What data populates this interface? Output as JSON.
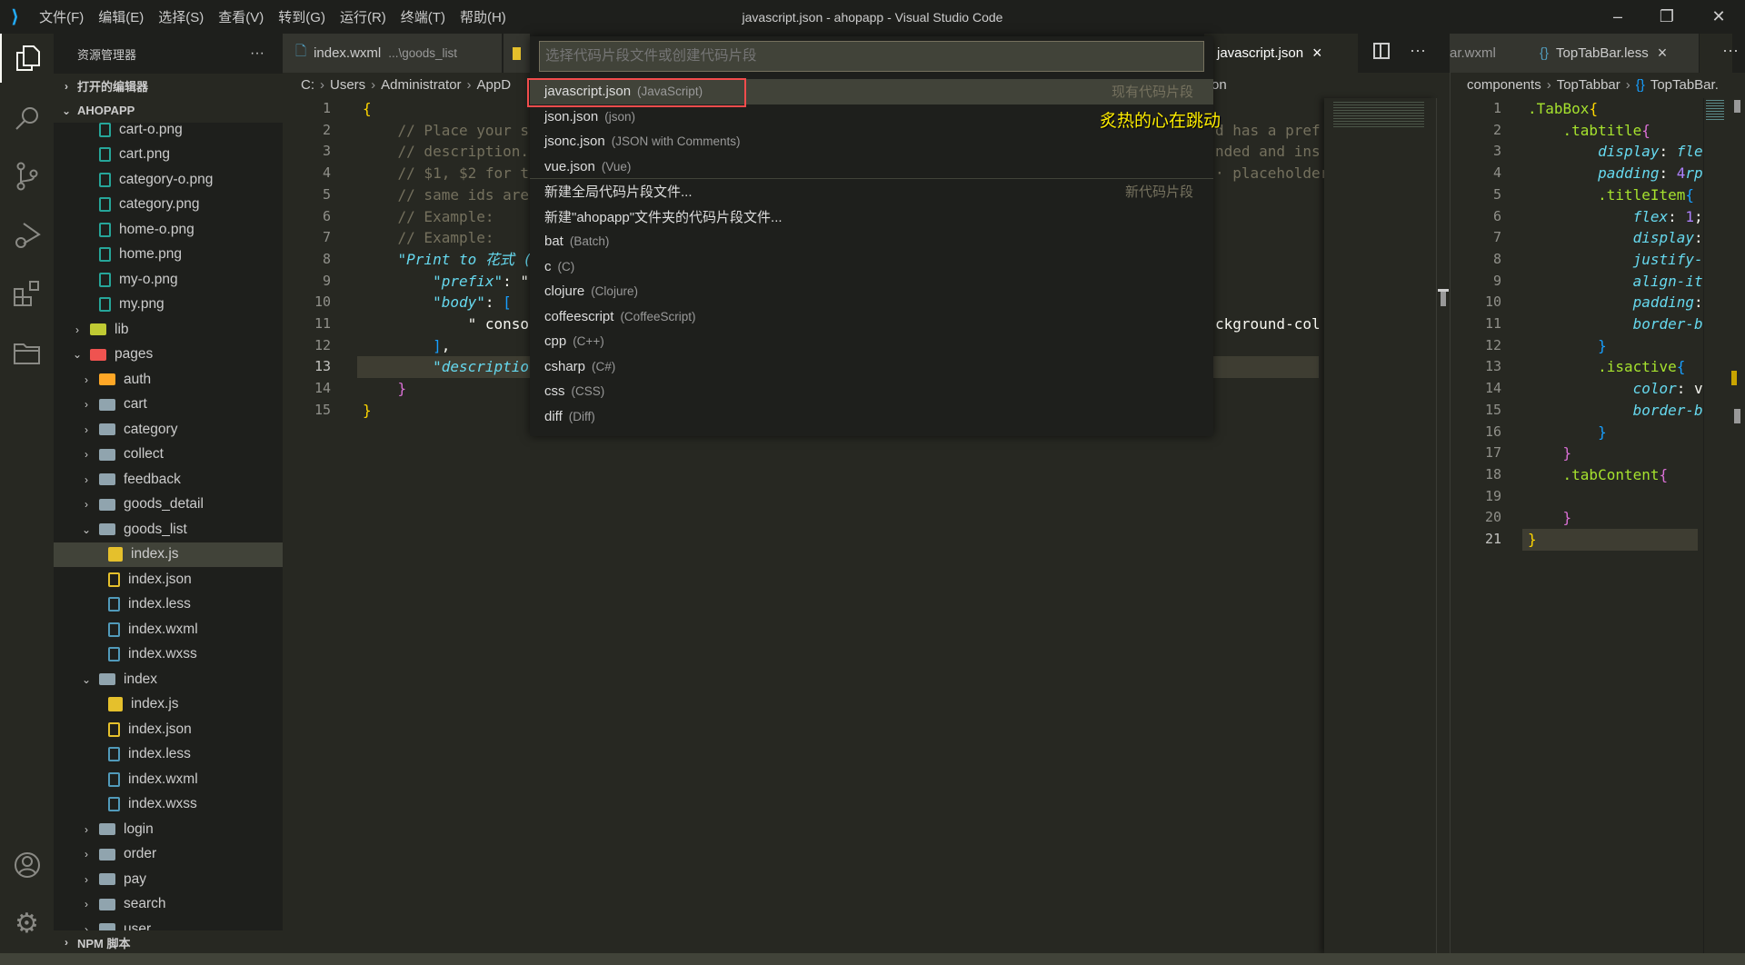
{
  "titlebar": {
    "menu": [
      "文件(F)",
      "编辑(E)",
      "选择(S)",
      "查看(V)",
      "转到(G)",
      "运行(R)",
      "终端(T)",
      "帮助(H)"
    ],
    "title": "javascript.json - ahopapp - Visual Studio Code"
  },
  "sidebar": {
    "title": "资源管理器",
    "more": "···",
    "open_editors": "打开的编辑器",
    "project": "AHOPAPP",
    "npm": "NPM 脚本",
    "tree": [
      {
        "label": "cart-o.png",
        "level": 2,
        "kind": "image"
      },
      {
        "label": "cart.png",
        "level": 2,
        "kind": "image"
      },
      {
        "label": "category-o.png",
        "level": 2,
        "kind": "image"
      },
      {
        "label": "category.png",
        "level": 2,
        "kind": "image"
      },
      {
        "label": "home-o.png",
        "level": 2,
        "kind": "image"
      },
      {
        "label": "home.png",
        "level": 2,
        "kind": "image"
      },
      {
        "label": "my-o.png",
        "level": 2,
        "kind": "image"
      },
      {
        "label": "my.png",
        "level": 2,
        "kind": "image"
      },
      {
        "label": "lib",
        "level": 1,
        "kind": "folder-lib",
        "open": false
      },
      {
        "label": "pages",
        "level": 1,
        "kind": "folder-pages",
        "open": true
      },
      {
        "label": "auth",
        "level": 2,
        "kind": "folder-auth",
        "open": false
      },
      {
        "label": "cart",
        "level": 2,
        "kind": "folder",
        "open": false
      },
      {
        "label": "category",
        "level": 2,
        "kind": "folder",
        "open": false
      },
      {
        "label": "collect",
        "level": 2,
        "kind": "folder",
        "open": false
      },
      {
        "label": "feedback",
        "level": 2,
        "kind": "folder",
        "open": false
      },
      {
        "label": "goods_detail",
        "level": 2,
        "kind": "folder",
        "open": false
      },
      {
        "label": "goods_list",
        "level": 2,
        "kind": "folder",
        "open": true
      },
      {
        "label": "index.js",
        "level": 3,
        "kind": "js",
        "selected": true
      },
      {
        "label": "index.json",
        "level": 3,
        "kind": "json"
      },
      {
        "label": "index.less",
        "level": 3,
        "kind": "less"
      },
      {
        "label": "index.wxml",
        "level": 3,
        "kind": "wxml"
      },
      {
        "label": "index.wxss",
        "level": 3,
        "kind": "wxss"
      },
      {
        "label": "index",
        "level": 2,
        "kind": "folder",
        "open": true
      },
      {
        "label": "index.js",
        "level": 3,
        "kind": "js"
      },
      {
        "label": "index.json",
        "level": 3,
        "kind": "json"
      },
      {
        "label": "index.less",
        "level": 3,
        "kind": "less"
      },
      {
        "label": "index.wxml",
        "level": 3,
        "kind": "wxml"
      },
      {
        "label": "index.wxss",
        "level": 3,
        "kind": "wxss"
      },
      {
        "label": "login",
        "level": 2,
        "kind": "folder",
        "open": false
      },
      {
        "label": "order",
        "level": 2,
        "kind": "folder",
        "open": false
      },
      {
        "label": "pay",
        "level": 2,
        "kind": "folder",
        "open": false
      },
      {
        "label": "search",
        "level": 2,
        "kind": "folder",
        "open": false
      },
      {
        "label": "user",
        "level": 2,
        "kind": "folder",
        "open": false
      }
    ]
  },
  "tabs": {
    "left": [
      {
        "label": "index.wxml",
        "desc": "...\\goods_list"
      },
      {
        "label": "javascript.json",
        "active": true,
        "close": "×"
      }
    ],
    "right": [
      {
        "label": "ar.wxml"
      },
      {
        "label": "TopTabBar.less",
        "close": "×"
      }
    ]
  },
  "breadcrumb_left": {
    "parts": [
      "C:",
      "Users",
      "Administrator",
      "AppD"
    ],
    "tail": "on"
  },
  "breadcrumb_right": {
    "parts": [
      "components",
      "TopTabbar",
      "TopTabBar."
    ]
  },
  "quickpick": {
    "placeholder": "选择代码片段文件或创建代码片段",
    "items": [
      {
        "label": "javascript.json",
        "desc": "(JavaScript)",
        "group": "现有代码片段",
        "active": true
      },
      {
        "label": "json.json",
        "desc": "(json)"
      },
      {
        "label": "jsonc.json",
        "desc": "(JSON with Comments)"
      },
      {
        "label": "vue.json",
        "desc": "(Vue)"
      },
      {
        "label": "新建全局代码片段文件...",
        "desc": "",
        "group": "新代码片段",
        "sep": true
      },
      {
        "label": "新建\"ahopapp\"文件夹的代码片段文件...",
        "desc": ""
      },
      {
        "label": "bat",
        "desc": "(Batch)"
      },
      {
        "label": "c",
        "desc": "(C)"
      },
      {
        "label": "clojure",
        "desc": "(Clojure)"
      },
      {
        "label": "coffeescript",
        "desc": "(CoffeeScript)"
      },
      {
        "label": "cpp",
        "desc": "(C++)"
      },
      {
        "label": "csharp",
        "desc": "(C#)"
      },
      {
        "label": "css",
        "desc": "(CSS)"
      },
      {
        "label": "diff",
        "desc": "(Diff)"
      }
    ]
  },
  "overlay_text": "炙热的心在跳动",
  "left_code": [
    {
      "n": "1",
      "t": [
        [
          "{",
          "brace"
        ]
      ]
    },
    {
      "n": "2",
      "t": [
        [
          "    // Place your s",
          "comment"
        ]
      ],
      "r": [
        [
          "d has a pref",
          "comment"
        ]
      ]
    },
    {
      "n": "3",
      "t": [
        [
          "    // description.",
          "comment"
        ]
      ],
      "r": [
        [
          "nded and ins",
          "comment"
        ]
      ]
    },
    {
      "n": "4",
      "t": [
        [
          "    // $1, $2 for t",
          "comment"
        ]
      ],
      "r": [
        [
          "· placeholder",
          "comment"
        ]
      ]
    },
    {
      "n": "5",
      "t": [
        [
          "    // same ids are",
          "comment"
        ]
      ]
    },
    {
      "n": "6",
      "t": [
        [
          "    // Example:",
          "comment"
        ]
      ]
    },
    {
      "n": "7",
      "t": [
        [
          "    // Example:",
          "comment"
        ]
      ]
    },
    {
      "n": "8",
      "t": [
        [
          "    \"Print to 花式 (",
          "key"
        ]
      ]
    },
    {
      "n": "9",
      "t": [
        [
          "        \"prefix\"",
          "key"
        ],
        [
          ": \"",
          "plain"
        ]
      ]
    },
    {
      "n": "10",
      "t": [
        [
          "        \"body\"",
          "key"
        ],
        [
          ": ",
          "plain"
        ],
        [
          "[",
          "bracket"
        ]
      ]
    },
    {
      "n": "11",
      "t": [
        [
          "            \" conso",
          "plain"
        ]
      ],
      "r": [
        [
          "ckground-col",
          "plain"
        ]
      ]
    },
    {
      "n": "12",
      "t": [
        [
          "        ",
          "plain"
        ],
        [
          "]",
          "bracket"
        ],
        [
          ",",
          "plain"
        ]
      ]
    },
    {
      "n": "13",
      "t": [
        [
          "        \"descriptio",
          "key"
        ]
      ],
      "current": true
    },
    {
      "n": "14",
      "t": [
        [
          "    ",
          "plain"
        ],
        [
          "}",
          "pink"
        ]
      ]
    },
    {
      "n": "15",
      "t": [
        [
          "}",
          "brace"
        ]
      ]
    }
  ],
  "right_code": [
    {
      "n": "1",
      "t": [
        [
          ".TabBox",
          "sel"
        ],
        [
          "{",
          "brace"
        ]
      ]
    },
    {
      "n": "2",
      "t": [
        [
          "    .tabtitle",
          "sel"
        ],
        [
          "{",
          "pink"
        ]
      ]
    },
    {
      "n": "3",
      "t": [
        [
          "        display",
          "prop"
        ],
        [
          ": ",
          "plain"
        ],
        [
          "fle",
          "val"
        ]
      ]
    },
    {
      "n": "4",
      "t": [
        [
          "        padding",
          "prop"
        ],
        [
          ": ",
          "plain"
        ],
        [
          "4",
          "num"
        ],
        [
          "rp",
          "val"
        ]
      ]
    },
    {
      "n": "5",
      "t": [
        [
          "        .titleItem",
          "sel"
        ],
        [
          "{",
          "bracket"
        ]
      ]
    },
    {
      "n": "6",
      "t": [
        [
          "            flex",
          "prop"
        ],
        [
          ": ",
          "plain"
        ],
        [
          "1",
          "num"
        ],
        [
          ";",
          "plain"
        ]
      ]
    },
    {
      "n": "7",
      "t": [
        [
          "            display",
          "prop"
        ],
        [
          ":",
          "plain"
        ]
      ]
    },
    {
      "n": "8",
      "t": [
        [
          "            justify-",
          "prop"
        ]
      ]
    },
    {
      "n": "9",
      "t": [
        [
          "            align-it",
          "prop"
        ]
      ]
    },
    {
      "n": "10",
      "t": [
        [
          "            padding",
          "prop"
        ],
        [
          ":",
          "plain"
        ]
      ]
    },
    {
      "n": "11",
      "t": [
        [
          "            border-b",
          "prop"
        ]
      ]
    },
    {
      "n": "12",
      "t": [
        [
          "        }",
          "bracket"
        ]
      ]
    },
    {
      "n": "13",
      "t": [
        [
          "        .isactive",
          "sel"
        ],
        [
          "{",
          "bracket"
        ]
      ]
    },
    {
      "n": "14",
      "t": [
        [
          "            color",
          "prop"
        ],
        [
          ": v",
          "plain"
        ]
      ]
    },
    {
      "n": "15",
      "t": [
        [
          "            border-b",
          "prop"
        ]
      ]
    },
    {
      "n": "16",
      "t": [
        [
          "        }",
          "bracket"
        ]
      ]
    },
    {
      "n": "17",
      "t": [
        [
          "    }",
          "pink"
        ]
      ]
    },
    {
      "n": "18",
      "t": [
        [
          "    .tabContent",
          "sel"
        ],
        [
          "{",
          "pink"
        ]
      ]
    },
    {
      "n": "19",
      "t": []
    },
    {
      "n": "20",
      "t": [
        [
          "    }",
          "pink"
        ]
      ]
    },
    {
      "n": "21",
      "t": [
        [
          "}",
          "brace"
        ]
      ],
      "current": true
    }
  ],
  "colors": {
    "comment": "#75715e",
    "key": "#66d9ef",
    "plain": "#f8f8f2",
    "brace": "#ffd700",
    "bracket": "#179fff",
    "pink": "#da70d6",
    "sel": "#a6e22e",
    "prop": "#66d9ef",
    "val": "#66d9ef",
    "num": "#ae81ff",
    "accent": "#f14c4c",
    "overlay": "#ffee00"
  }
}
